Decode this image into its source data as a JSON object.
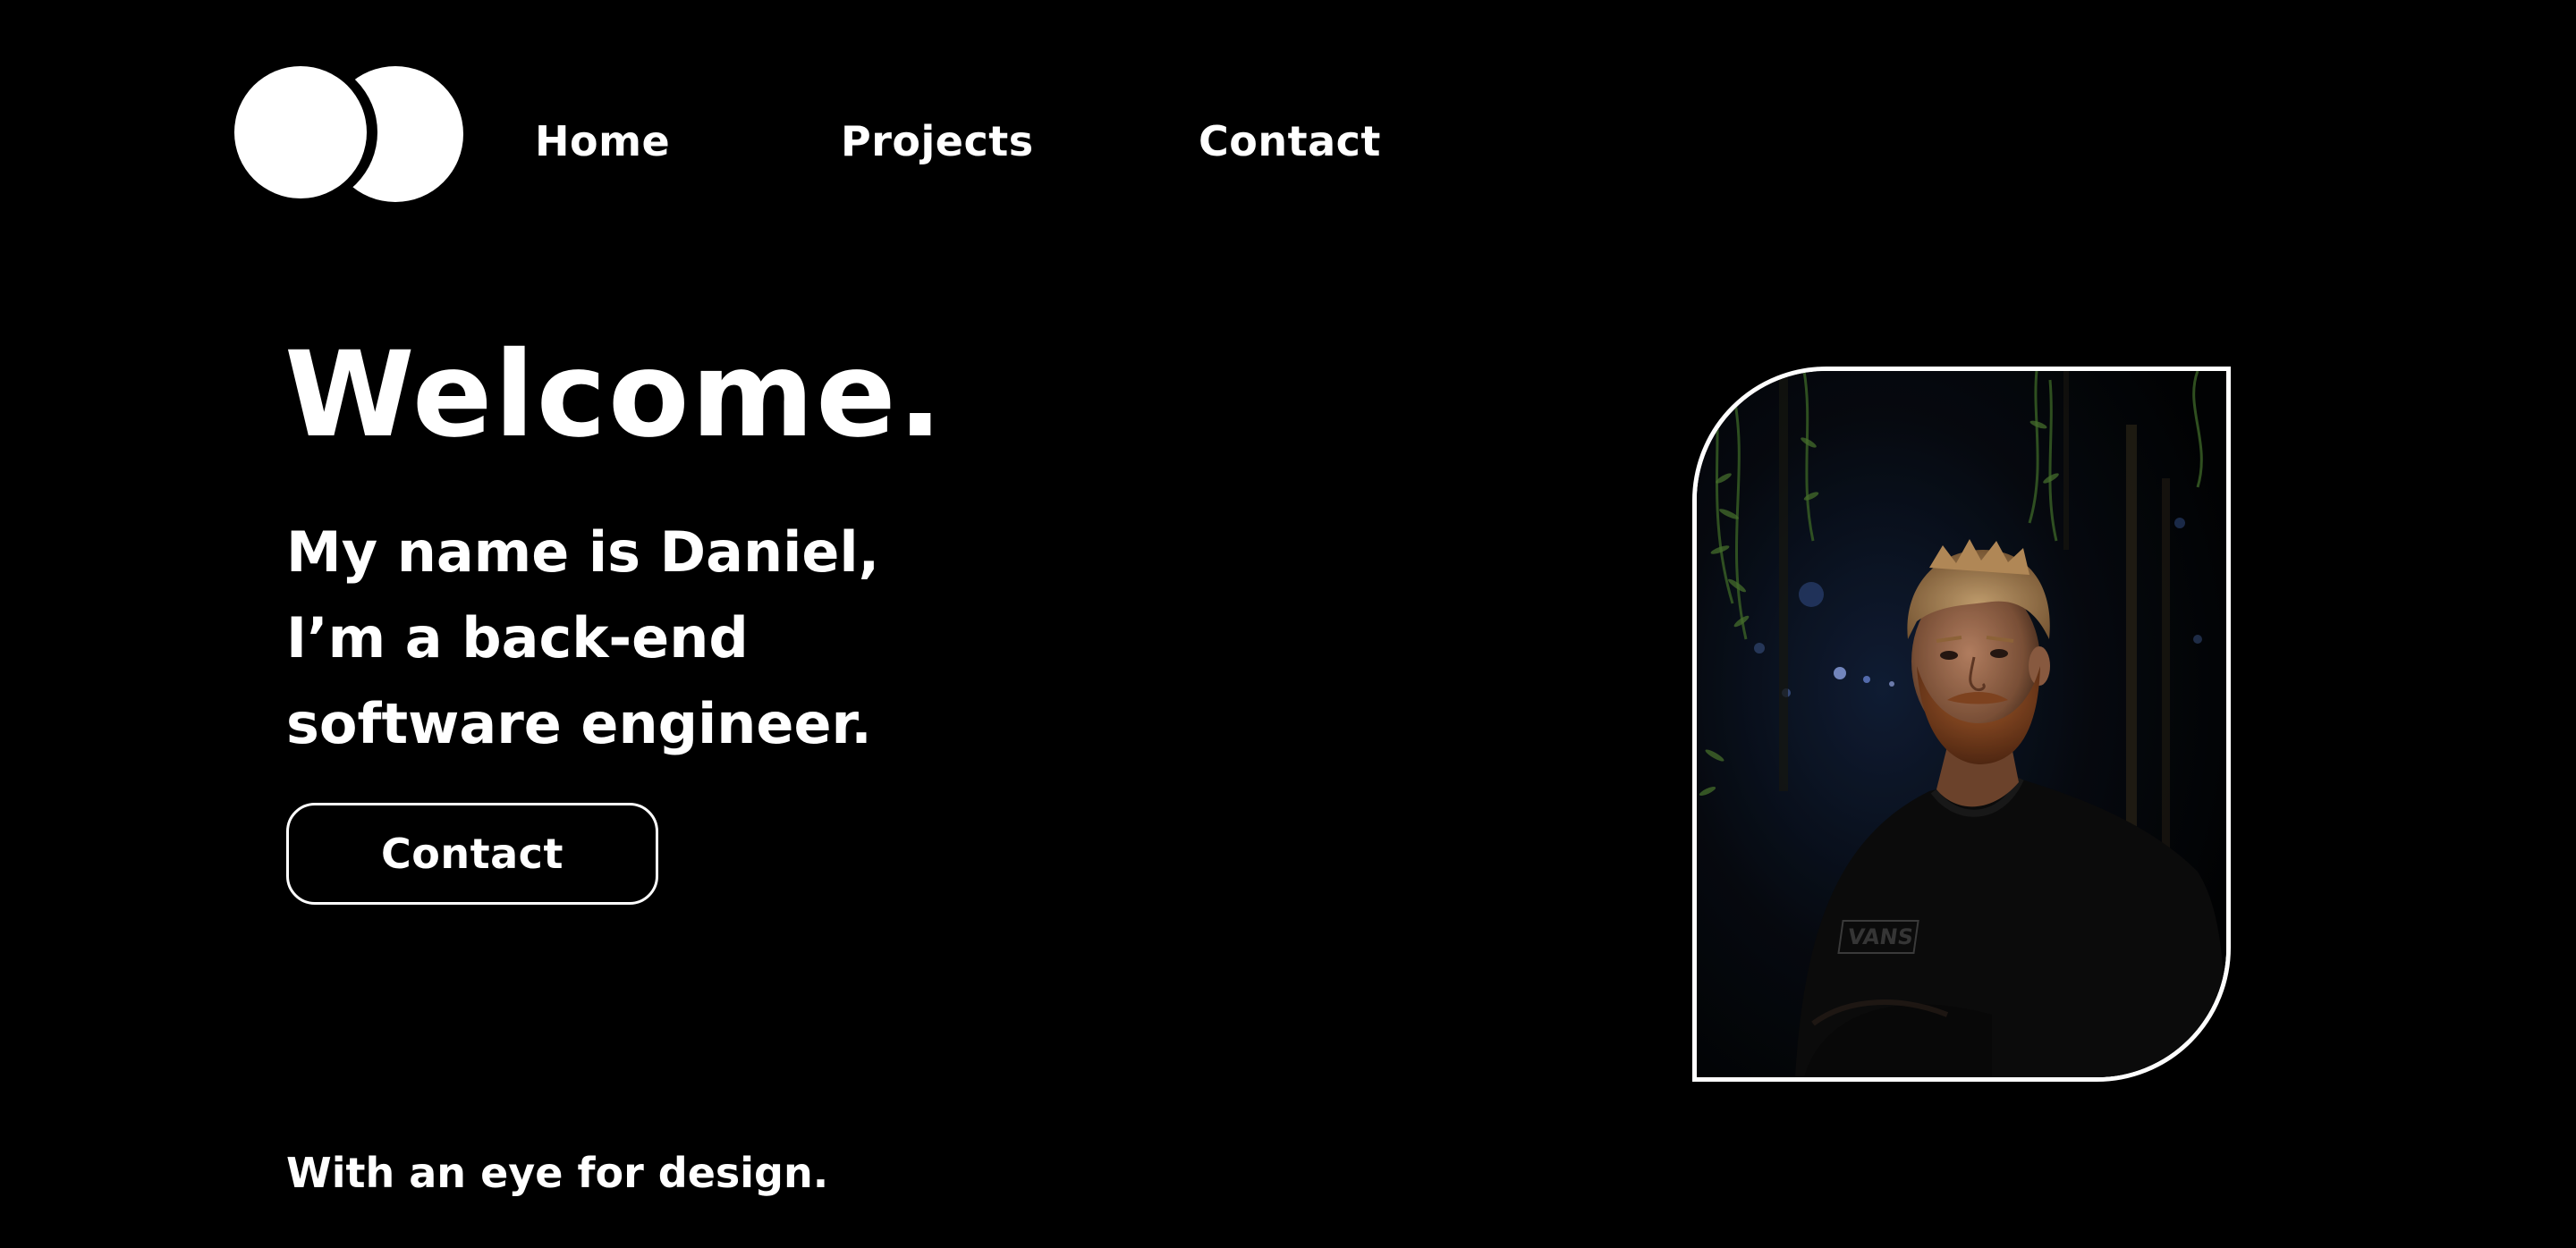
{
  "logo": {
    "icon": "two-circles-logo-icon",
    "color": "#ffffff"
  },
  "nav": {
    "items": [
      {
        "label": "Home"
      },
      {
        "label": "Projects"
      },
      {
        "label": "Contact"
      }
    ]
  },
  "hero": {
    "title": "Welcome.",
    "intro_lines": [
      "My name is Daniel,",
      "I’m a back-end",
      "software engineer."
    ],
    "cta_label": "Contact"
  },
  "portrait": {
    "alt": "Portrait photo of Daniel at night among trees, wearing a black Vans t-shirt",
    "shirt_logo": "VANS"
  },
  "tagline": "With an eye for design.",
  "colors": {
    "background": "#000000",
    "foreground": "#ffffff"
  }
}
